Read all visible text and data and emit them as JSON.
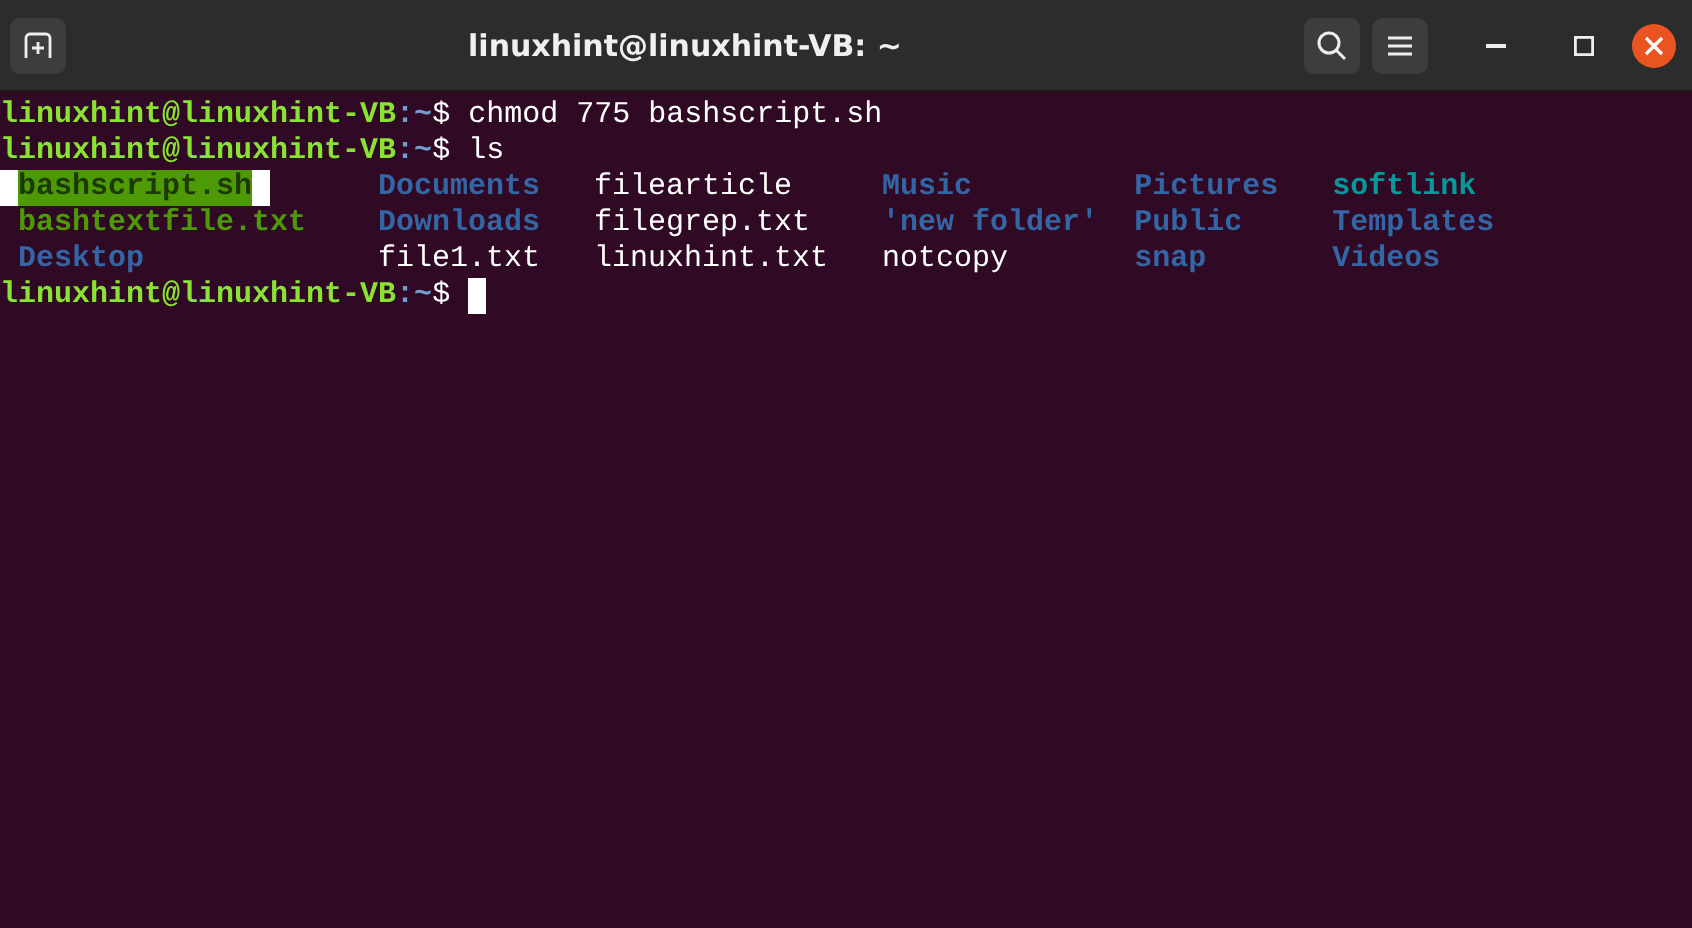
{
  "window": {
    "title": "linuxhint@linuxhint-VB: ~"
  },
  "lines": [
    {
      "kind": "prompt",
      "user": "linuxhint@linuxhint-VB",
      "path": ":~",
      "symbol": "$",
      "command": "chmod 775 bashscript.sh",
      "cursor": false
    },
    {
      "kind": "prompt",
      "user": "linuxhint@linuxhint-VB",
      "path": ":~",
      "symbol": "$",
      "command": "ls",
      "cursor": false
    },
    {
      "kind": "listing",
      "entries": [
        {
          "name": "bashscript.sh",
          "kind": "exec",
          "highlighted": true
        },
        {
          "name": "Documents",
          "kind": "dir",
          "highlighted": false
        },
        {
          "name": "filearticle",
          "kind": "file",
          "highlighted": false
        },
        {
          "name": "Music",
          "kind": "dir",
          "highlighted": false
        },
        {
          "name": "Pictures",
          "kind": "dir",
          "highlighted": false
        },
        {
          "name": "softlink",
          "kind": "link",
          "highlighted": false
        },
        {
          "name": "bashtextfile.txt",
          "kind": "exec",
          "highlighted": false
        },
        {
          "name": "Downloads",
          "kind": "dir",
          "highlighted": false
        },
        {
          "name": "filegrep.txt",
          "kind": "file",
          "highlighted": false
        },
        {
          "name": "'new folder'",
          "kind": "dir",
          "highlighted": false
        },
        {
          "name": "Public",
          "kind": "dir",
          "highlighted": false
        },
        {
          "name": "Templates",
          "kind": "dir",
          "highlighted": false
        },
        {
          "name": "Desktop",
          "kind": "dir",
          "highlighted": false
        },
        {
          "name": "file1.txt",
          "kind": "file",
          "highlighted": false
        },
        {
          "name": "linuxhint.txt",
          "kind": "file",
          "highlighted": false
        },
        {
          "name": "notcopy",
          "kind": "file",
          "highlighted": false
        },
        {
          "name": "snap",
          "kind": "dir",
          "highlighted": false
        },
        {
          "name": "Videos",
          "kind": "dir",
          "highlighted": false
        }
      ]
    },
    {
      "kind": "prompt",
      "user": "linuxhint@linuxhint-VB",
      "path": ":~",
      "symbol": "$",
      "cursor": true
    }
  ]
}
